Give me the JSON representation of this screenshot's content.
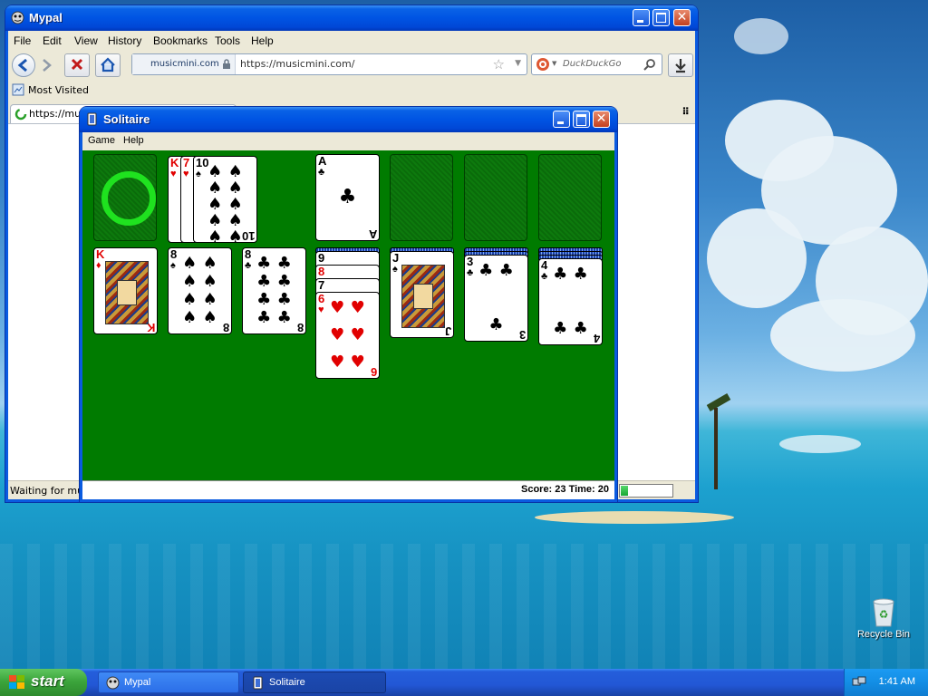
{
  "browser": {
    "title": "Mypal",
    "menu": [
      "File",
      "Edit",
      "View",
      "History",
      "Bookmarks",
      "Tools",
      "Help"
    ],
    "site_identity": "musicmini.com",
    "url": "https://musicmini.com/",
    "search_placeholder": "DuckDuckGo",
    "bookmark_item": "Most Visited",
    "tab_label": "https://musi",
    "status_text": "Waiting for music",
    "progress": 0.15
  },
  "solitaire": {
    "title": "Solitaire",
    "menu": [
      "Game",
      "Help"
    ],
    "score_text": "Score: 23 Time: 20",
    "felt_color": "#007b00",
    "waste": [
      {
        "rank": "K",
        "suit": "hearts"
      },
      {
        "rank": "7",
        "suit": "hearts"
      },
      {
        "rank": "10",
        "suit": "spades"
      }
    ],
    "foundation": {
      "rank": "A",
      "suit": "clubs"
    },
    "tableau": [
      {
        "hidden": 0,
        "cards": [
          {
            "rank": "K",
            "suit": "diamonds"
          }
        ]
      },
      {
        "hidden": 0,
        "cards": [
          {
            "rank": "8",
            "suit": "spades"
          }
        ]
      },
      {
        "hidden": 0,
        "cards": [
          {
            "rank": "8",
            "suit": "clubs"
          }
        ]
      },
      {
        "hidden": 1,
        "cards": [
          {
            "rank": "9",
            "suit": "spades"
          },
          {
            "rank": "8",
            "suit": "hearts"
          },
          {
            "rank": "7",
            "suit": "spades"
          },
          {
            "rank": "6",
            "suit": "hearts"
          }
        ]
      },
      {
        "hidden": 1,
        "cards": [
          {
            "rank": "J",
            "suit": "spades"
          }
        ]
      },
      {
        "hidden": 2,
        "cards": [
          {
            "rank": "3",
            "suit": "clubs"
          }
        ]
      },
      {
        "hidden": 3,
        "cards": [
          {
            "rank": "4",
            "suit": "clubs"
          }
        ]
      }
    ]
  },
  "taskbar": {
    "start_label": "start",
    "tasks": [
      "Mypal",
      "Solitaire"
    ],
    "clock": "1:41 AM"
  },
  "desktop": {
    "recycle_bin_label": "Recycle Bin"
  }
}
